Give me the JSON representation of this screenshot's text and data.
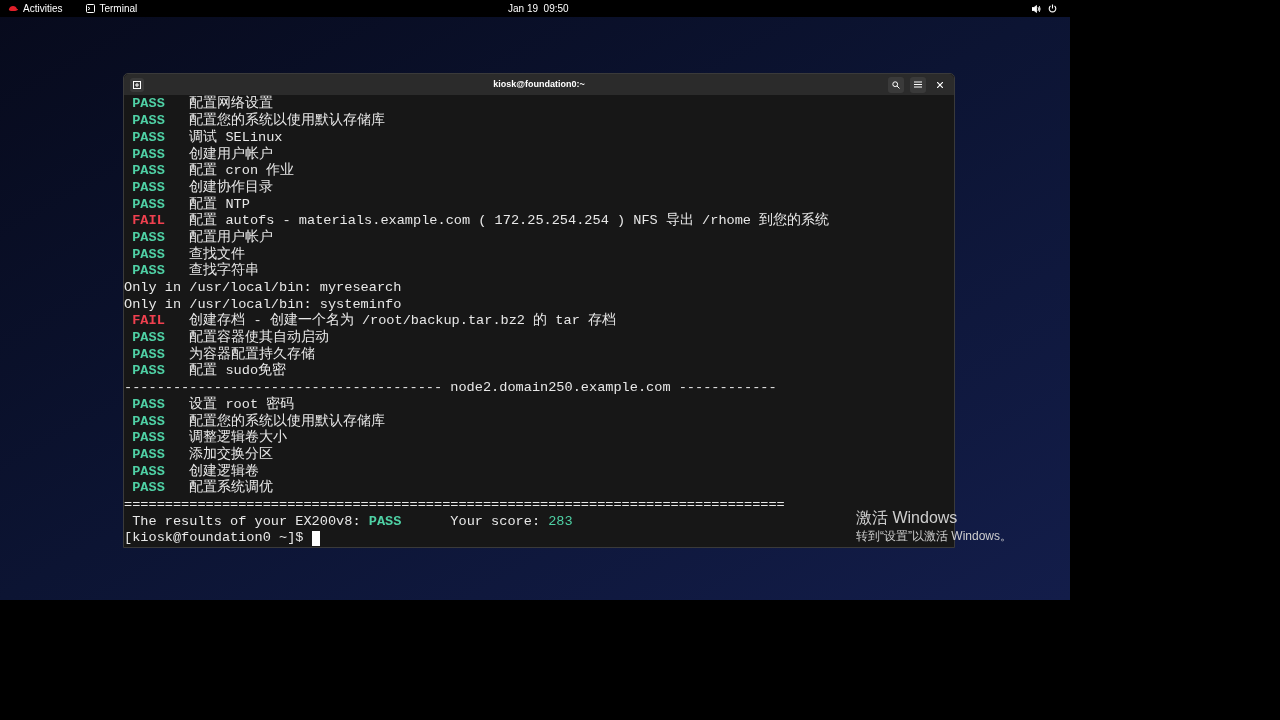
{
  "top_bar": {
    "activities": "Activities",
    "app": "Terminal",
    "clock": "Jan 19  09:50"
  },
  "terminal": {
    "title": "kiosk@foundation0:~",
    "lines": [
      {
        "kind": "result",
        "status": "PASS",
        "passed": true,
        "text": "配置网络设置"
      },
      {
        "kind": "result",
        "status": "PASS",
        "passed": true,
        "text": "配置您的系统以使用默认存储库"
      },
      {
        "kind": "result",
        "status": "PASS",
        "passed": true,
        "text": "调试 SELinux"
      },
      {
        "kind": "result",
        "status": "PASS",
        "passed": true,
        "text": "创建用户帐户"
      },
      {
        "kind": "result",
        "status": "PASS",
        "passed": true,
        "text": "配置 cron 作业"
      },
      {
        "kind": "result",
        "status": "PASS",
        "passed": true,
        "text": "创建协作目录"
      },
      {
        "kind": "result",
        "status": "PASS",
        "passed": true,
        "text": "配置 NTP"
      },
      {
        "kind": "result",
        "status": "FAIL",
        "passed": false,
        "text": "配置 autofs - materials.example.com ( 172.25.254.254 ) NFS 导出 /rhome 到您的系统"
      },
      {
        "kind": "result",
        "status": "PASS",
        "passed": true,
        "text": "配置用户帐户"
      },
      {
        "kind": "result",
        "status": "PASS",
        "passed": true,
        "text": "查找文件"
      },
      {
        "kind": "result",
        "status": "PASS",
        "passed": true,
        "text": "查找字符串"
      },
      {
        "kind": "plain",
        "text": "Only in /usr/local/bin: myresearch"
      },
      {
        "kind": "plain",
        "text": "Only in /usr/local/bin: systeminfo"
      },
      {
        "kind": "result",
        "status": "FAIL",
        "passed": false,
        "text": "创建存档 - 创建一个名为 /root/backup.tar.bz2 的 tar 存档"
      },
      {
        "kind": "result",
        "status": "PASS",
        "passed": true,
        "text": "配置容器使其自动启动"
      },
      {
        "kind": "result",
        "status": "PASS",
        "passed": true,
        "text": "为容器配置持久存储"
      },
      {
        "kind": "result",
        "status": "PASS",
        "passed": true,
        "text": "配置 sudo免密"
      },
      {
        "kind": "separator",
        "text": "--------------------------------------- node2.domain250.example.com ------------"
      },
      {
        "kind": "result",
        "status": "PASS",
        "passed": true,
        "text": "设置 root 密码"
      },
      {
        "kind": "result",
        "status": "PASS",
        "passed": true,
        "text": "配置您的系统以使用默认存储库"
      },
      {
        "kind": "result",
        "status": "PASS",
        "passed": true,
        "text": "调整逻辑卷大小"
      },
      {
        "kind": "result",
        "status": "PASS",
        "passed": true,
        "text": "添加交换分区"
      },
      {
        "kind": "result",
        "status": "PASS",
        "passed": true,
        "text": "创建逻辑卷"
      },
      {
        "kind": "result",
        "status": "PASS",
        "passed": true,
        "text": "配置系统调优"
      },
      {
        "kind": "separator",
        "text": "================================================================================="
      },
      {
        "kind": "summary",
        "label": "The results of your EX200v8:",
        "status": "PASS",
        "passed": true,
        "score_label": "Your score:",
        "score": "283"
      }
    ],
    "prompt": "[kiosk@foundation0 ~]$"
  },
  "activation_notice": {
    "title": "激活 Windows",
    "subtitle": "转到“设置”以激活 Windows。"
  }
}
